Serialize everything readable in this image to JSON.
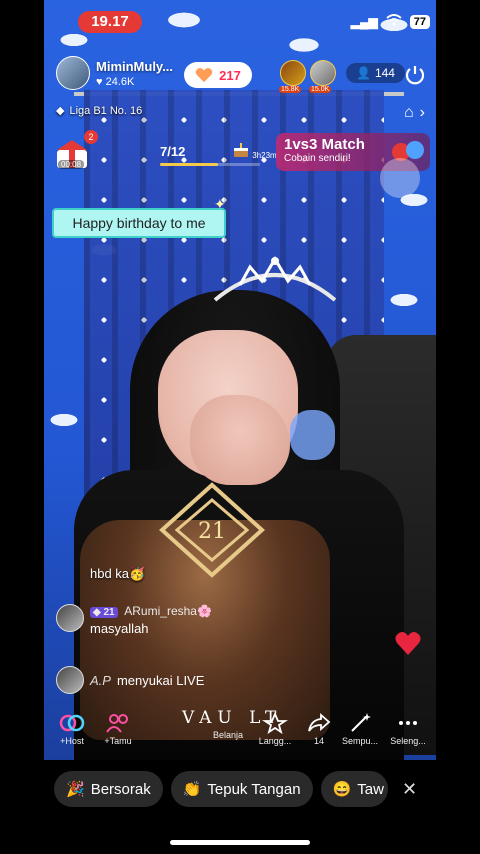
{
  "status": {
    "time": "19.17",
    "battery": "77"
  },
  "host": {
    "name": "MiminMuly...",
    "likes": "24.6K"
  },
  "heart_button": {
    "count": "217"
  },
  "viewers": {
    "top1_tag": "15.8K",
    "top2_tag": "15.0K",
    "count": "144"
  },
  "league": {
    "label": "Liga B1 No. 16"
  },
  "gift": {
    "badge": "2",
    "timer": "00:08"
  },
  "progress": {
    "label": "7/12",
    "fraction": 0.58
  },
  "cake_timer": {
    "label": "3h23m"
  },
  "match": {
    "title": "1vs3 Match",
    "subtitle": "Cobain sendiri!"
  },
  "banner": {
    "text": "Happy birthday to me"
  },
  "chat": {
    "msg1": "hbd ka🥳",
    "msg2": {
      "level": "21",
      "user": "ARumi_resha🌸",
      "text": "masyallah"
    },
    "like": {
      "user": "A.P",
      "text": "menyukai LIVE"
    }
  },
  "watermark": "VAU LT",
  "toolbar": {
    "host": "+Host",
    "tamu": "+Tamu",
    "belanja": "Belanja",
    "langganan": "Langg...",
    "share_count": "14",
    "sempurna": "Sempu...",
    "lainnya": "Seleng..."
  },
  "reactions": {
    "bersorak": "Bersorak",
    "tepuk": "Tepuk Tangan",
    "tawa": "Taw"
  },
  "colors": {
    "accent_red": "#e53935",
    "heart_pink": "#ff2d55",
    "banner_bg": "#aff6f3"
  }
}
